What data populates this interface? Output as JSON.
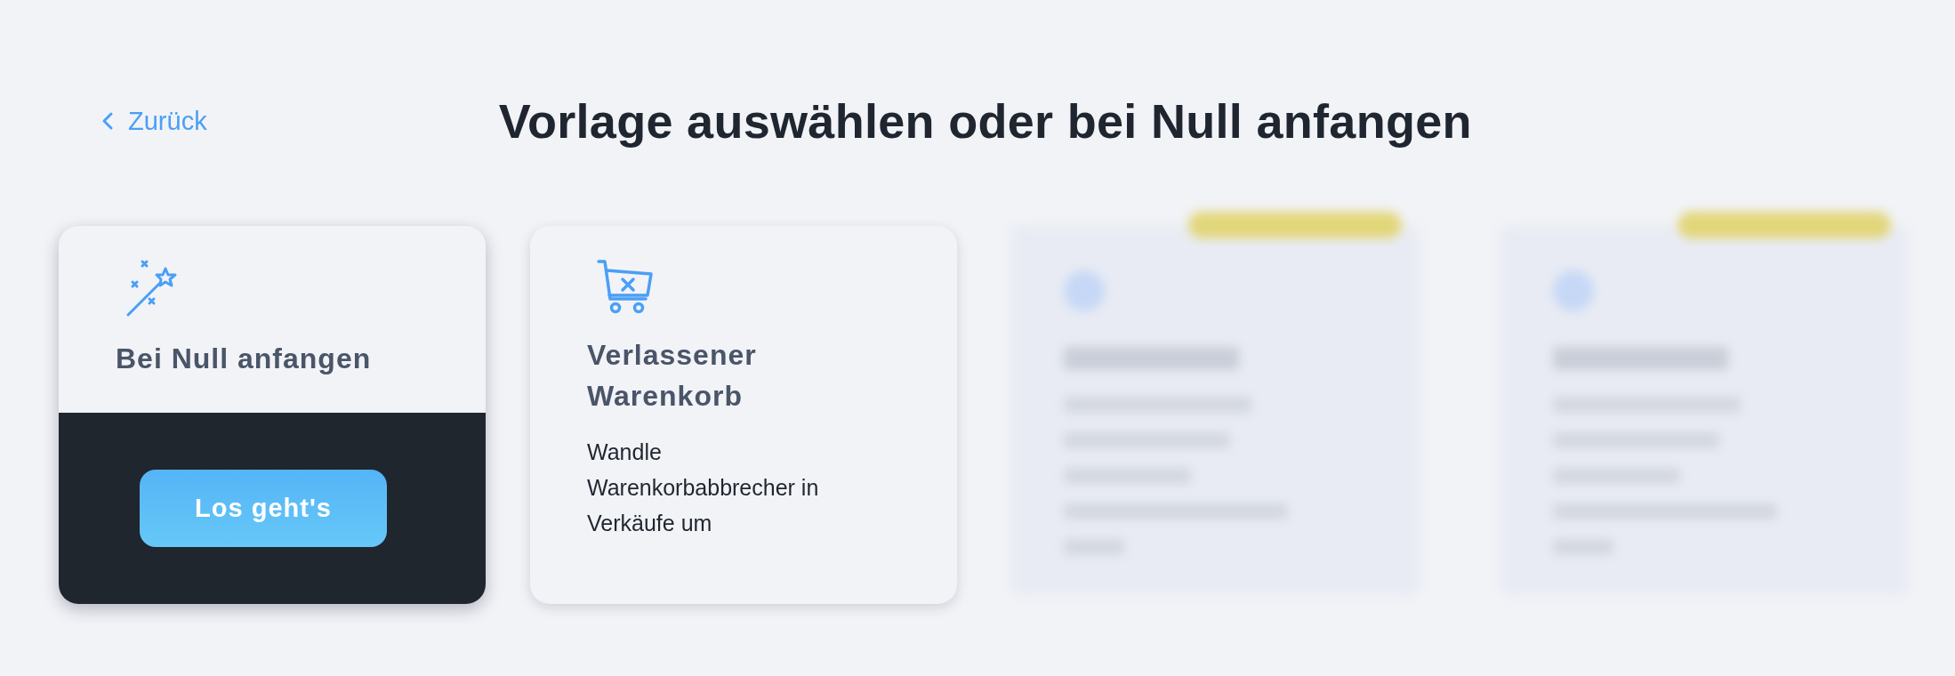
{
  "back_link": {
    "label": "Zurück"
  },
  "title": "Vorlage auswählen oder bei Null anfangen",
  "cards": [
    {
      "kind": "scratch",
      "title": "Bei Null anfangen",
      "active": true,
      "button": "Los geht's"
    },
    {
      "kind": "template",
      "title": "Verlassener Warenkorb",
      "description": "Wandle Warenkorbabbrecher in Verkäufe um",
      "active": false
    }
  ],
  "blurred_cards": [
    {
      "kind": "blurred"
    },
    {
      "kind": "blurred"
    }
  ]
}
